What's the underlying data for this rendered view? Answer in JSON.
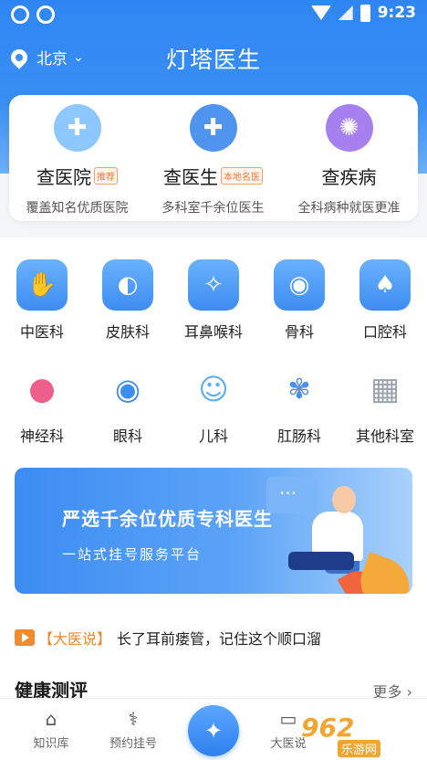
{
  "status": {
    "time": "9:23"
  },
  "header": {
    "city": "北京",
    "title": "灯塔医生"
  },
  "services": [
    {
      "name": "查医院",
      "tag": "推荐",
      "desc": "覆盖知名优质医院",
      "icon": "hospital-icon",
      "color": "#7fc0ff"
    },
    {
      "name": "查医生",
      "tag": "本地名医",
      "desc": "多科室千余位医生",
      "icon": "doctor-icon",
      "color": "#5aa0f5"
    },
    {
      "name": "查疾病",
      "tag": "",
      "desc": "全科病种就医更准",
      "icon": "virus-icon",
      "color": "#a87ef0"
    }
  ],
  "departments": [
    {
      "label": "中医科",
      "icon": "tcm-hand-icon",
      "glyph": "✋"
    },
    {
      "label": "皮肤科",
      "icon": "skin-icon",
      "glyph": "◐"
    },
    {
      "label": "耳鼻喉科",
      "icon": "ent-icon",
      "glyph": "✧"
    },
    {
      "label": "骨科",
      "icon": "eye-bone-icon",
      "glyph": "◉"
    },
    {
      "label": "口腔科",
      "icon": "tooth-icon",
      "glyph": "♠"
    },
    {
      "label": "神经科",
      "icon": "brain-icon",
      "glyph": "●"
    },
    {
      "label": "眼科",
      "icon": "eye-icon",
      "glyph": "◉"
    },
    {
      "label": "儿科",
      "icon": "baby-icon",
      "glyph": "☺"
    },
    {
      "label": "肛肠科",
      "icon": "intestine-icon",
      "glyph": "✾"
    },
    {
      "label": "其他科室",
      "icon": "grid-icon",
      "glyph": "▦"
    }
  ],
  "banner": {
    "headline": "严选千余位优质专科医生",
    "subline": "一站式挂号服务平台"
  },
  "news": {
    "source": "【大医说】",
    "text": "长了耳前瘘管，记住这个顺口溜"
  },
  "section": {
    "title": "健康测评",
    "more": "更多 ›"
  },
  "tabs": [
    {
      "label": "知识库",
      "icon": "graduation-cap-icon",
      "glyph": "🎓"
    },
    {
      "label": "预约挂号",
      "icon": "stethoscope-icon",
      "glyph": "⚕"
    },
    {
      "label": "大医说",
      "icon": "tv-icon",
      "glyph": "📺"
    }
  ],
  "watermark": {
    "big": "962",
    "sm": "乐游网"
  }
}
